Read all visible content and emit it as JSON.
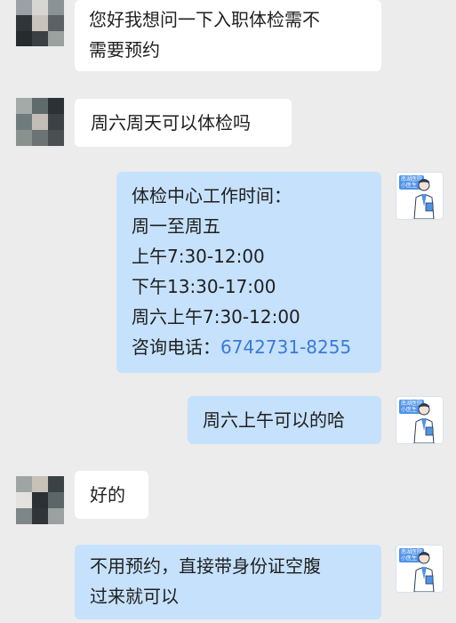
{
  "messages": [
    {
      "side": "in",
      "lines": [
        "您好我想问一下入职体检需不",
        "需要预约"
      ]
    },
    {
      "side": "in",
      "lines": [
        "周六周天可以体检吗"
      ]
    },
    {
      "side": "out",
      "lines": [
        "体检中心工作时间：",
        "周一至周五",
        "上午7:30-12:00",
        "下午13:30-17:00",
        "周六上午7:30-12:00"
      ],
      "phone_label": "咨询电话：",
      "phone_number": "6742731-8255"
    },
    {
      "side": "out",
      "lines": [
        "周六上午可以的哈"
      ]
    },
    {
      "side": "in",
      "lines": [
        "好的"
      ]
    },
    {
      "side": "out",
      "lines": [
        "不用预约，直接带身份证空腹",
        "过来就可以"
      ]
    }
  ],
  "doctor_avatar": {
    "badge_lines": [
      "南湖医院",
      "小医生"
    ]
  },
  "colors": {
    "background": "#ececec",
    "incoming_bubble": "#ffffff",
    "outgoing_bubble": "#c6e1fb",
    "phone_link": "#3b7ad9"
  }
}
